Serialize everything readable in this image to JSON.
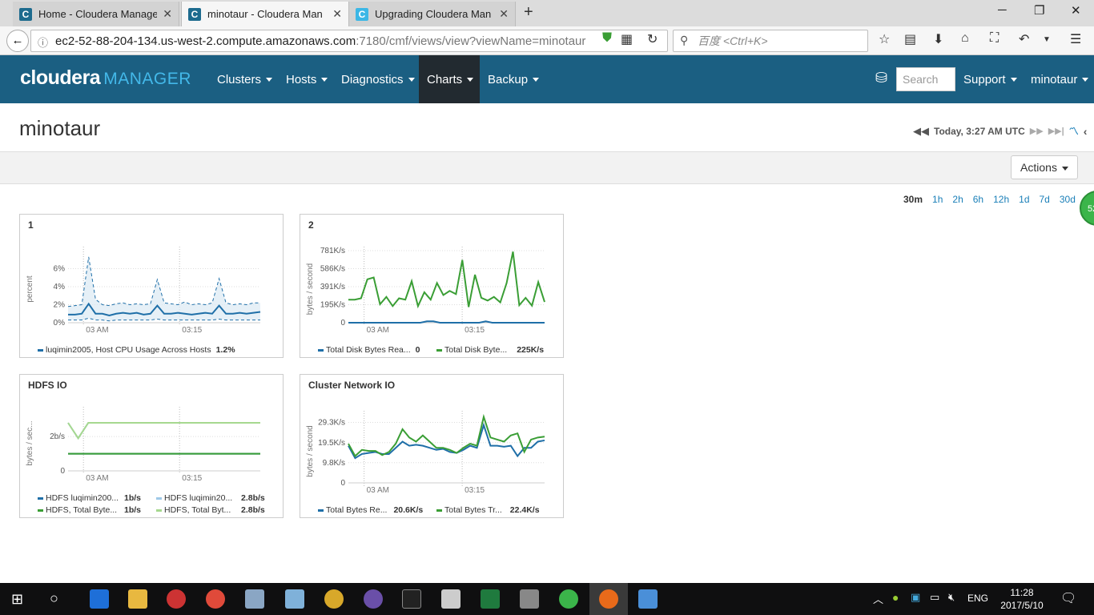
{
  "browser": {
    "tabs": [
      {
        "title": "Home - Cloudera Manage",
        "favicon": "C",
        "active": false
      },
      {
        "title": "minotaur - Cloudera Man",
        "favicon": "C",
        "active": true
      },
      {
        "title": "Upgrading Cloudera Man",
        "favicon": "C",
        "active": false
      }
    ],
    "new_tab": "+",
    "url_host": "ec2-52-88-204-134.us-west-2.compute.amazonaws.com",
    "url_rest": ":7180/cmf/views/view?viewName=minotaur",
    "search_placeholder": "百度 <Ctrl+K>"
  },
  "header": {
    "logo_main": "cloudera",
    "logo_sub": "MANAGER",
    "menus": [
      {
        "label": "Clusters"
      },
      {
        "label": "Hosts"
      },
      {
        "label": "Diagnostics"
      },
      {
        "label": "Charts"
      },
      {
        "label": "Backup"
      }
    ],
    "search_placeholder": "Search",
    "support": "Support",
    "user": "minotaur"
  },
  "page": {
    "title": "minotaur",
    "time": "Today, 3:27 AM UTC",
    "actions": "Actions",
    "ranges": [
      "30m",
      "1h",
      "2h",
      "6h",
      "12h",
      "1d",
      "7d",
      "30d"
    ],
    "selected_range": "30m",
    "badge": "52"
  },
  "chart_data": [
    {
      "type": "line",
      "title": "1",
      "ylabel": "percent",
      "y_ticks": [
        "6%",
        "4%",
        "2%",
        "0%"
      ],
      "x_ticks": [
        "03 AM",
        "03:15"
      ],
      "ylim": [
        0,
        8
      ],
      "series": [
        {
          "name": "luqimin2005, Host CPU Usage Across Hosts",
          "value_label": "1.2%",
          "color": "#1f6fa8",
          "values": [
            0.9,
            0.9,
            1.0,
            2.1,
            1.0,
            1.0,
            0.8,
            1.0,
            1.1,
            1.0,
            1.1,
            0.9,
            1.0,
            1.9,
            1.0,
            1.0,
            1.1,
            1.0,
            0.9,
            1.0,
            1.1,
            1.0,
            1.9,
            1.0,
            1.0,
            1.1,
            1.0,
            1.1,
            1.2
          ],
          "upper": [
            1.8,
            1.9,
            2.0,
            7.3,
            2.6,
            2.0,
            1.9,
            2.1,
            2.2,
            2.0,
            2.1,
            2.0,
            2.1,
            4.8,
            2.2,
            2.1,
            2.0,
            2.3,
            2.0,
            2.1,
            2.0,
            2.2,
            4.9,
            2.2,
            2.0,
            2.1,
            2.0,
            2.2,
            2.2
          ],
          "lower": [
            0.3,
            0.3,
            0.3,
            0.5,
            0.3,
            0.3,
            0.2,
            0.3,
            0.3,
            0.3,
            0.3,
            0.3,
            0.3,
            0.4,
            0.3,
            0.3,
            0.3,
            0.3,
            0.3,
            0.3,
            0.3,
            0.3,
            0.4,
            0.3,
            0.3,
            0.3,
            0.3,
            0.3,
            0.3
          ]
        }
      ]
    },
    {
      "type": "line",
      "title": "2",
      "ylabel": "bytes / second",
      "y_ticks": [
        "781K/s",
        "586K/s",
        "391K/s",
        "195K/s",
        "0"
      ],
      "x_ticks": [
        "03 AM",
        "03:15"
      ],
      "ylim": [
        0,
        781
      ],
      "series": [
        {
          "name": "Total Disk Bytes Rea...",
          "value_label": "0",
          "color": "#1f6fa8",
          "values": [
            0,
            0,
            0,
            0,
            0,
            0,
            0,
            0,
            0,
            0,
            0,
            0,
            15,
            15,
            0,
            0,
            0,
            0,
            0,
            0,
            0,
            15,
            0,
            0,
            0,
            0,
            0,
            0,
            0,
            0,
            0
          ]
        },
        {
          "name": "Total Disk Byte...",
          "value_label": "225K/s",
          "color": "#3a9e35",
          "values": [
            250,
            250,
            265,
            470,
            490,
            200,
            280,
            180,
            265,
            250,
            450,
            180,
            330,
            250,
            430,
            300,
            345,
            310,
            680,
            170,
            520,
            270,
            240,
            280,
            220,
            430,
            770,
            190,
            270,
            185,
            440,
            225
          ]
        }
      ]
    },
    {
      "type": "line",
      "title": "HDFS IO",
      "ylabel": "bytes / sec...",
      "y_ticks": [
        "2b/s",
        "0"
      ],
      "x_ticks": [
        "03 AM",
        "03:15"
      ],
      "ylim": [
        0,
        3.5
      ],
      "series": [
        {
          "name": "HDFS luqimin200...",
          "value_label": "1b/s",
          "color": "#1f6fa8",
          "values": [
            1,
            1,
            1,
            1,
            1,
            1,
            1,
            1,
            1,
            1,
            1,
            1,
            1,
            1,
            1,
            1,
            1,
            1,
            1,
            1
          ]
        },
        {
          "name": "HDFS luqimin20...",
          "value_label": "2.8b/s",
          "color": "#9ec9e8",
          "values": [
            2.8,
            1.9,
            2.8,
            2.8,
            2.8,
            2.8,
            2.8,
            2.8,
            2.8,
            2.8,
            2.8,
            2.8,
            2.8,
            2.8,
            2.8,
            2.8,
            2.8,
            2.8,
            2.8,
            2.8
          ]
        },
        {
          "name": "HDFS, Total Byte...",
          "value_label": "1b/s",
          "color": "#3a9e35",
          "values": [
            1,
            1,
            1,
            1,
            1,
            1,
            1,
            1,
            1,
            1,
            1,
            1,
            1,
            1,
            1,
            1,
            1,
            1,
            1,
            1
          ]
        },
        {
          "name": "HDFS, Total Byt...",
          "value_label": "2.8b/s",
          "color": "#a6d88f",
          "values": [
            2.8,
            1.9,
            2.8,
            2.8,
            2.8,
            2.8,
            2.8,
            2.8,
            2.8,
            2.8,
            2.8,
            2.8,
            2.8,
            2.8,
            2.8,
            2.8,
            2.8,
            2.8,
            2.8,
            2.8
          ]
        }
      ]
    },
    {
      "type": "line",
      "title": "Cluster Network IO",
      "ylabel": "bytes / second",
      "y_ticks": [
        "29.3K/s",
        "19.5K/s",
        "9.8K/s",
        "0"
      ],
      "x_ticks": [
        "03 AM",
        "03:15"
      ],
      "ylim": [
        0,
        33
      ],
      "series": [
        {
          "name": "Total Bytes Re...",
          "value_label": "20.6K/s",
          "color": "#1f6fa8",
          "values": [
            18,
            12,
            14,
            14.5,
            15,
            14,
            14,
            17,
            20,
            18,
            18.5,
            18,
            17,
            16,
            16.5,
            15,
            14.5,
            16,
            18,
            17,
            28,
            18,
            18,
            17.5,
            18,
            13,
            17,
            17,
            20,
            20.6
          ]
        },
        {
          "name": "Total Bytes Tr...",
          "value_label": "22.4K/s",
          "color": "#3a9e35",
          "values": [
            19,
            13,
            16,
            15.5,
            15.5,
            13.5,
            15,
            19,
            26,
            22,
            20,
            23,
            20,
            17,
            17,
            16,
            14.5,
            17,
            19,
            18,
            32,
            22,
            21,
            20,
            23,
            24,
            15,
            21,
            22,
            22.4
          ]
        }
      ]
    }
  ],
  "taskbar": {
    "lang": "ENG",
    "time": "11:28",
    "date": "2017/5/10"
  }
}
